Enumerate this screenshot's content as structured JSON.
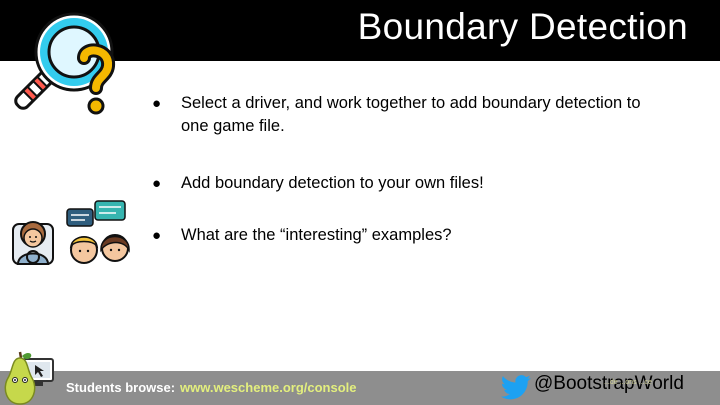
{
  "slide": {
    "title": "Boundary Detection",
    "bullets": [
      "Select a driver, and work together to add boundary detection to one game file.",
      "Add boundary detection to your own files!",
      "What are the “interesting” examples?"
    ]
  },
  "footer": {
    "students_label": "Students browse:",
    "url": "www.wescheme.org/console",
    "twitter_handle": "@BootstrapWorld",
    "license_text": "...de ...ons ...ce"
  },
  "icons": {
    "magnifier": "magnifier-question-icon",
    "twitter": "twitter-bird-icon",
    "pear": "pear-mascot-icon",
    "computer": "computer-icon",
    "driver": "driver-person-icon",
    "discussion": "discussion-people-icon"
  },
  "colors": {
    "title_bar": "#000000",
    "footer_bar": "#8e8e8e",
    "url_green": "#e3ef7e",
    "twitter_blue": "#1da1f2",
    "magnifier_cyan": "#33ccee",
    "question_yellow": "#f5b800"
  }
}
